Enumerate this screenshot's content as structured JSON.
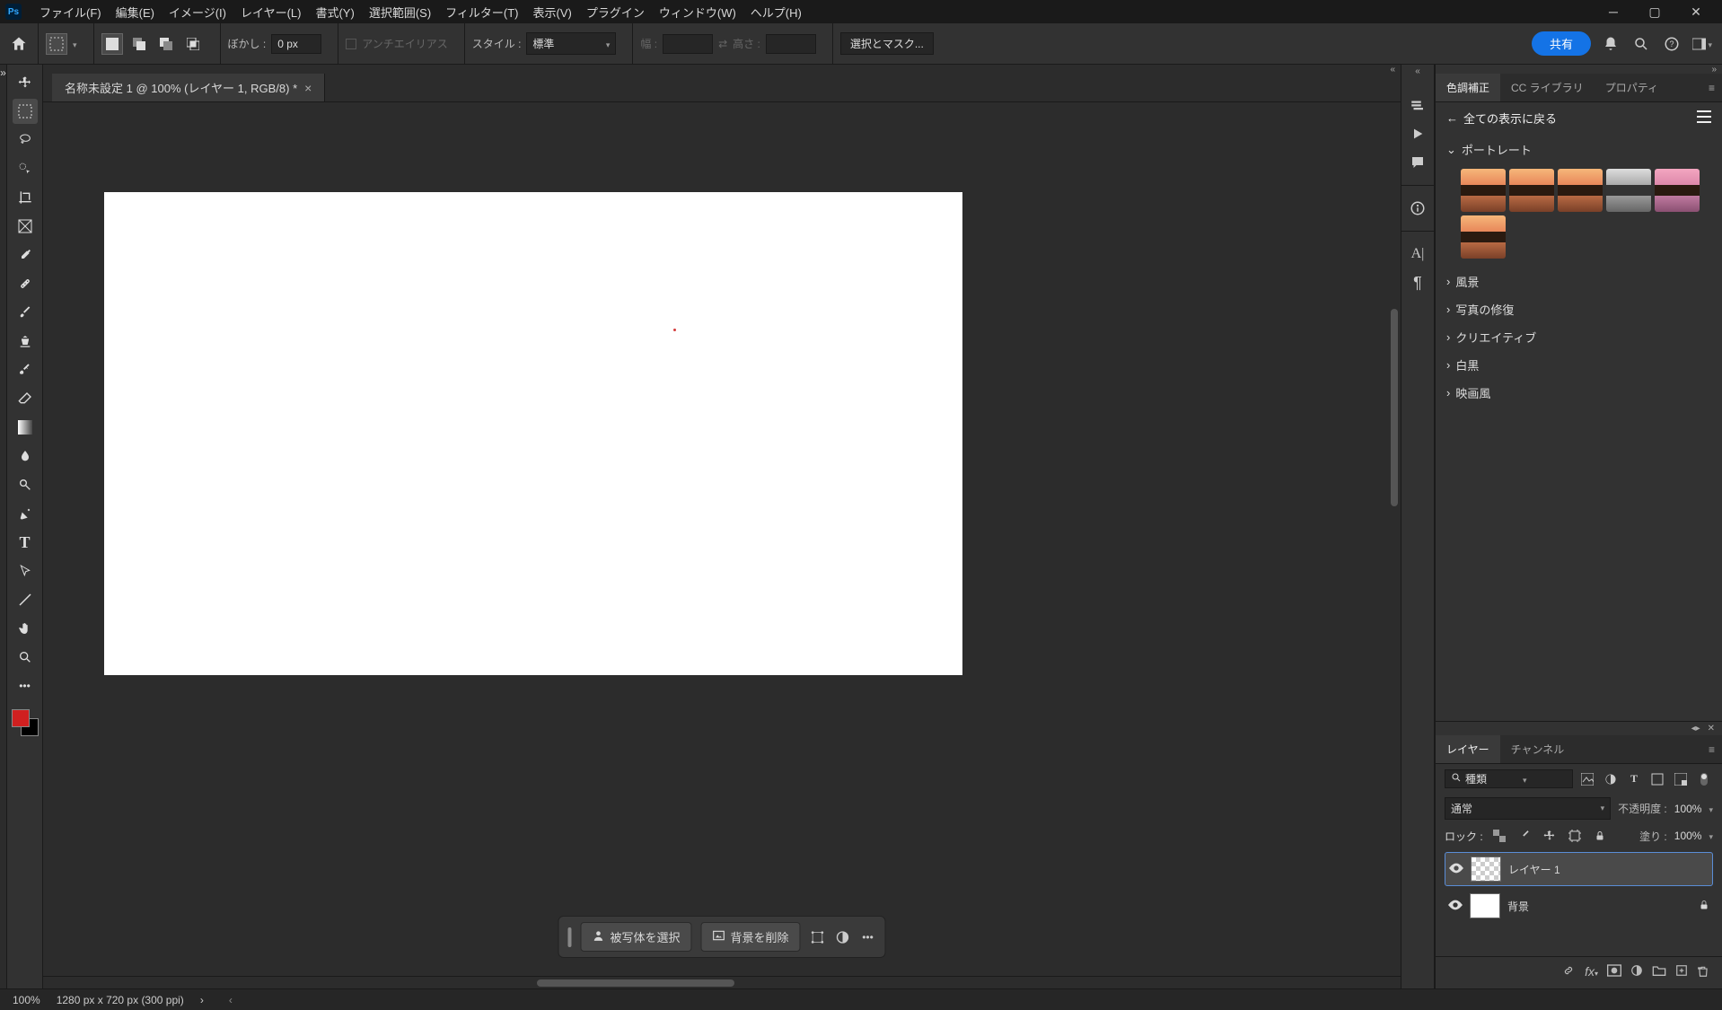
{
  "menu": {
    "file": "ファイル(F)",
    "edit": "編集(E)",
    "image": "イメージ(I)",
    "layer": "レイヤー(L)",
    "type": "書式(Y)",
    "select": "選択範囲(S)",
    "filter": "フィルター(T)",
    "view": "表示(V)",
    "plugins": "プラグイン",
    "window": "ウィンドウ(W)",
    "help": "ヘルプ(H)"
  },
  "options": {
    "blur_label": "ぼかし :",
    "blur_value": "0 px",
    "antialias": "アンチエイリアス",
    "style_label": "スタイル :",
    "style_value": "標準",
    "width_label": "幅 :",
    "height_label": "高さ :",
    "select_mask": "選択とマスク...",
    "share": "共有"
  },
  "doc": {
    "tab_title": "名称未設定 1 @ 100% (レイヤー 1, RGB/8) *"
  },
  "floating": {
    "select_subject": "被写体を選択",
    "remove_bg": "背景を削除"
  },
  "panels": {
    "adjustments": "色調補正",
    "cc_lib": "CC ライブラリ",
    "properties": "プロパティ",
    "back_all": "全ての表示に戻る",
    "cat_portrait": "ポートレート",
    "cat_landscape": "風景",
    "cat_photo_repair": "写真の修復",
    "cat_creative": "クリエイティブ",
    "cat_bw": "白黒",
    "cat_cinema": "映画風",
    "layers_tab": "レイヤー",
    "channels_tab": "チャンネル",
    "kind_label": "種類",
    "blend_mode": "通常",
    "opacity_label": "不透明度 :",
    "opacity_value": "100%",
    "lock_label": "ロック :",
    "fill_label": "塗り :",
    "fill_value": "100%",
    "layer1_name": "レイヤー 1",
    "bg_layer_name": "背景"
  },
  "status": {
    "zoom": "100%",
    "doc_info": "1280 px x 720 px (300 ppi)"
  }
}
